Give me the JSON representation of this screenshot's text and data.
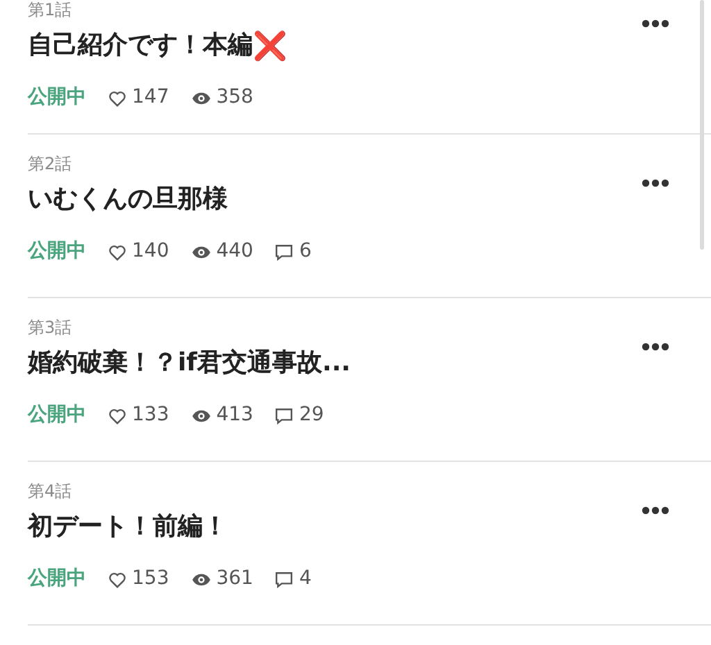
{
  "episodes": [
    {
      "number": "第1話",
      "title": "自己紹介です！本編",
      "title_mark": "❌",
      "status": "公開中",
      "likes": "147",
      "views": "358"
    },
    {
      "number": "第2話",
      "title": "いむくんの旦那様",
      "status": "公開中",
      "likes": "140",
      "views": "440",
      "comments": "6"
    },
    {
      "number": "第3話",
      "title": "婚約破棄！？if君交通事故...",
      "status": "公開中",
      "likes": "133",
      "views": "413",
      "comments": "29"
    },
    {
      "number": "第4話",
      "title": "初デート！前編！",
      "status": "公開中",
      "likes": "153",
      "views": "361",
      "comments": "4"
    }
  ]
}
